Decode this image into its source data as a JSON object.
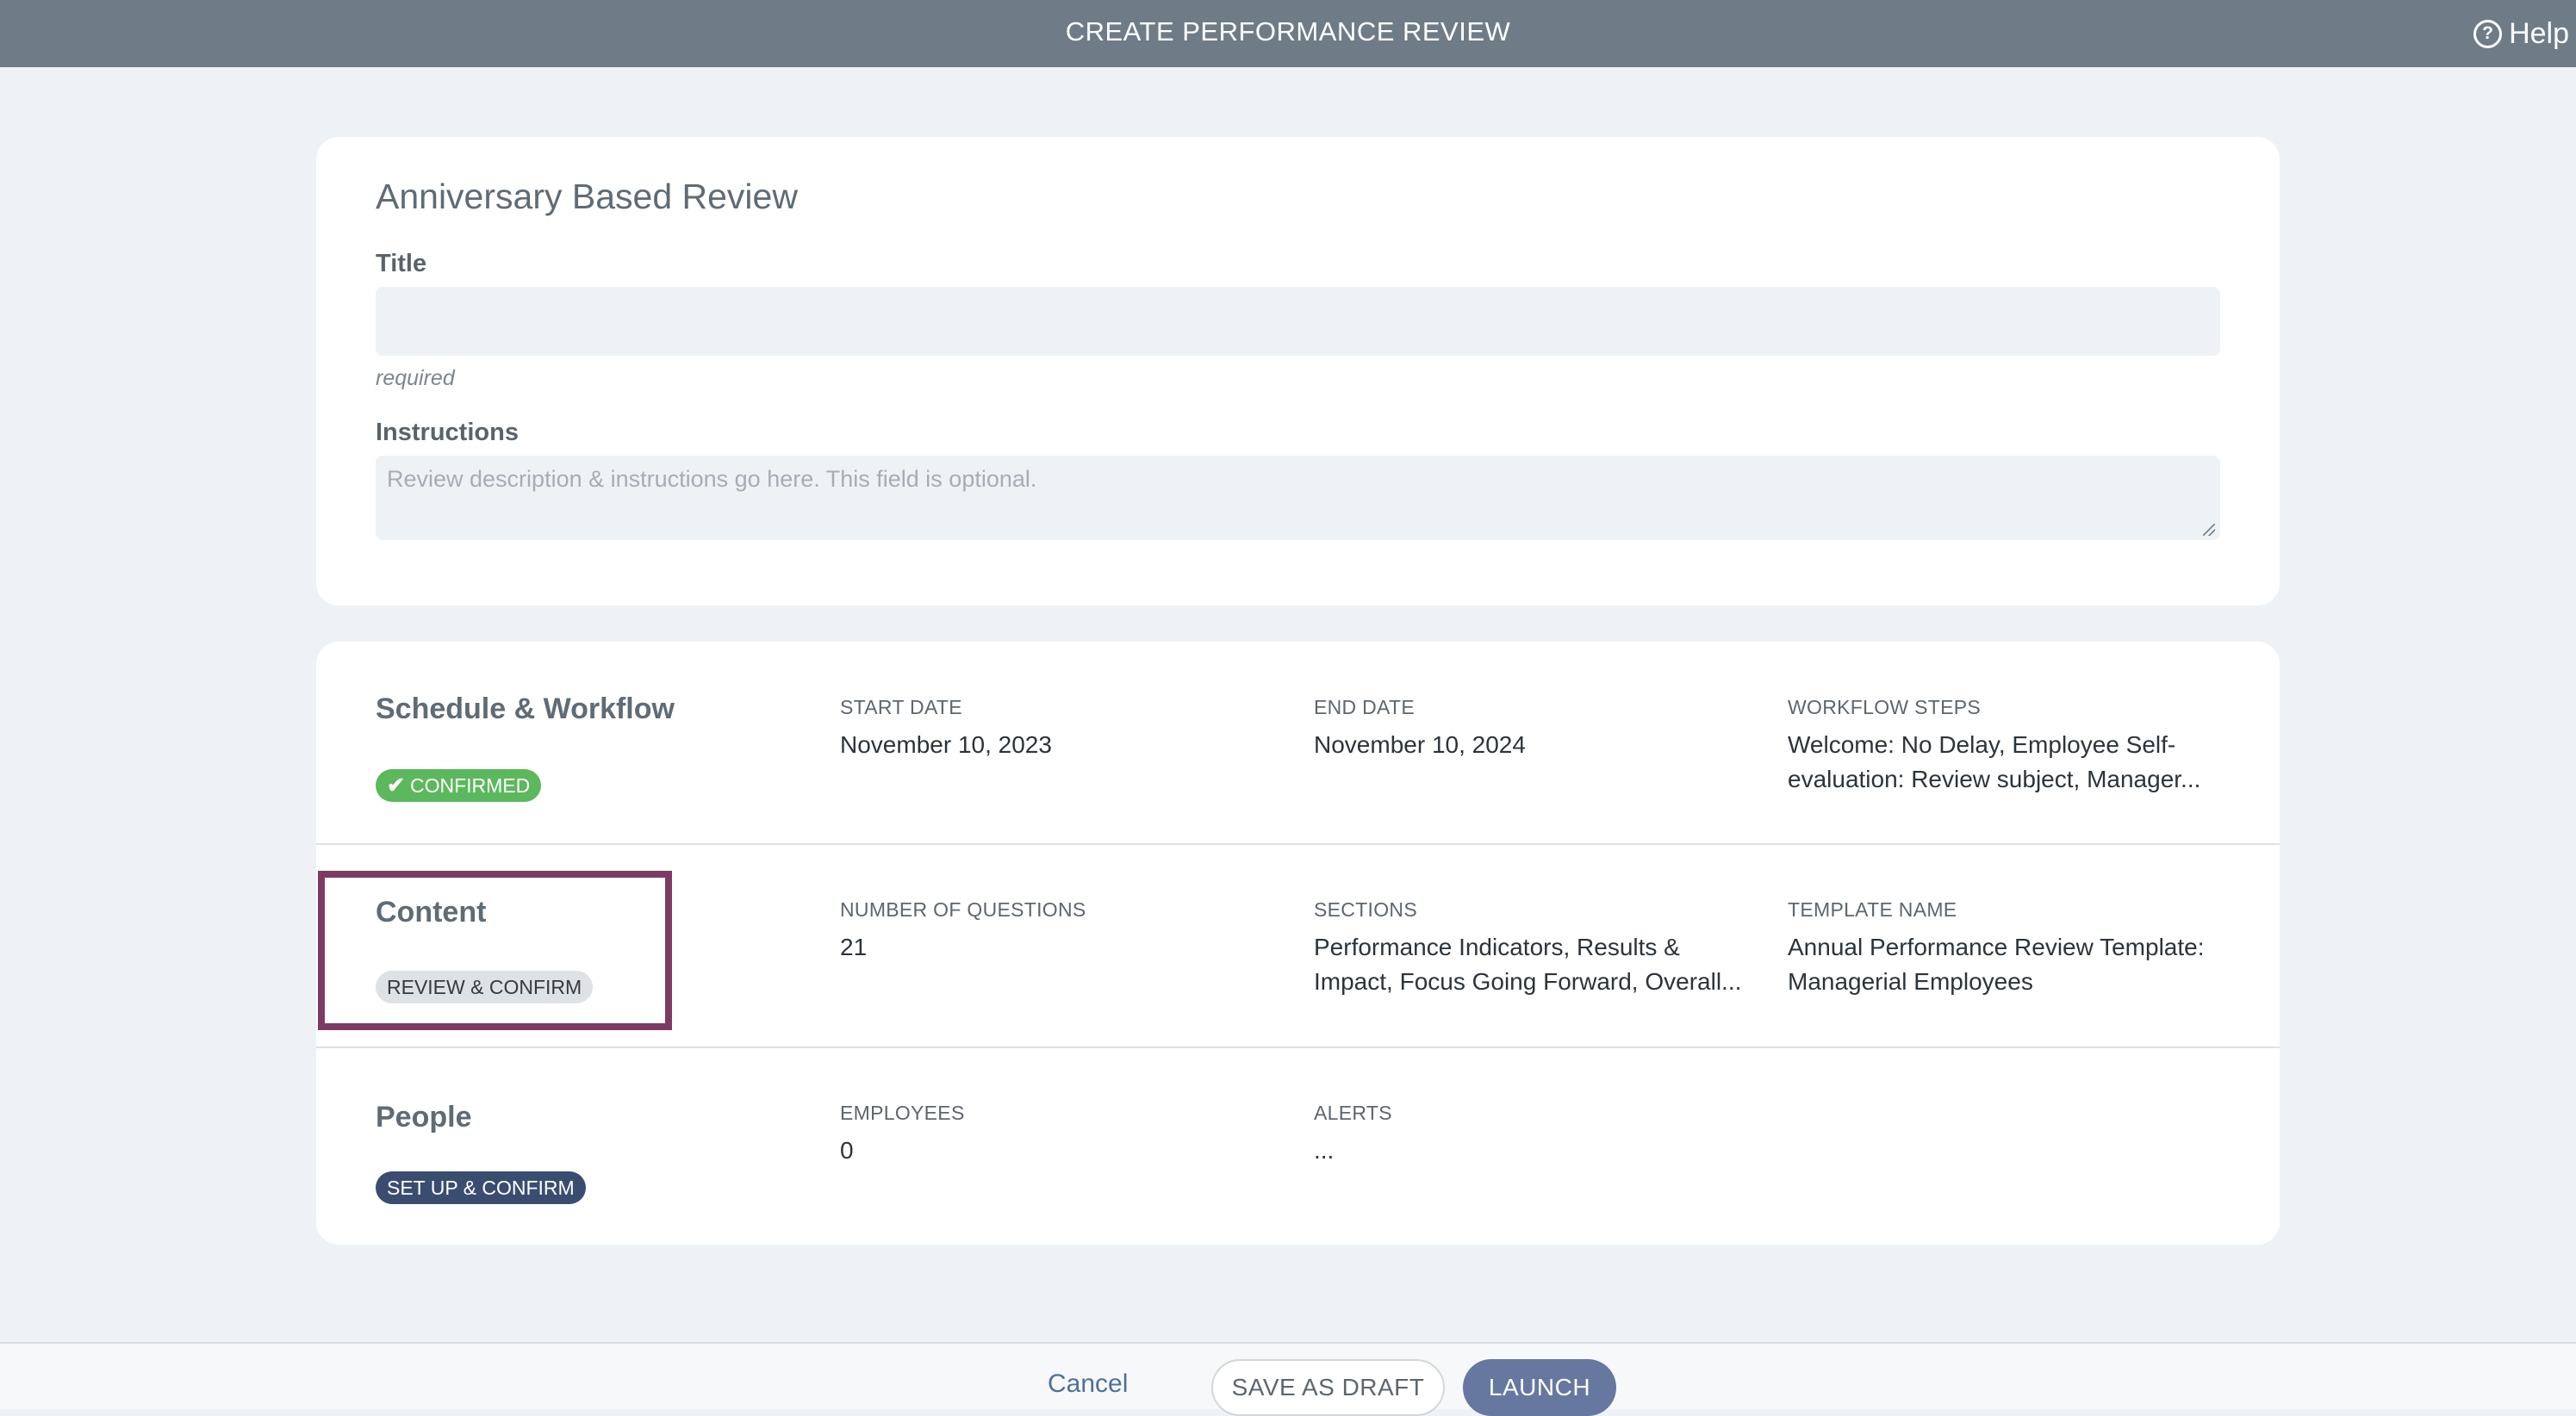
{
  "header": {
    "title": "CREATE PERFORMANCE REVIEW",
    "help_label": "Help"
  },
  "form": {
    "review_type": "Anniversary Based Review",
    "title_label": "Title",
    "title_value": "",
    "title_hint": "required",
    "instructions_label": "Instructions",
    "instructions_placeholder": "Review description & instructions go here.  This field is optional."
  },
  "sections": {
    "schedule": {
      "title": "Schedule & Workflow",
      "badge": "CONFIRMED",
      "start_label": "START DATE",
      "start_value": "November 10, 2023",
      "end_label": "END DATE",
      "end_value": "November 10, 2024",
      "workflow_label": "WORKFLOW STEPS",
      "workflow_line1": "Welcome: No Delay, Employee Self-",
      "workflow_line2": "evaluation: Review subject, Manager..."
    },
    "content": {
      "title": "Content",
      "badge": "REVIEW & CONFIRM",
      "questions_label": "NUMBER OF QUESTIONS",
      "questions_value": "21",
      "sections_label": "SECTIONS",
      "sections_line1": "Performance Indicators, Results &",
      "sections_line2": "Impact, Focus Going Forward, Overall...",
      "template_label": "TEMPLATE NAME",
      "template_line1": "Annual Performance Review Template:",
      "template_line2": "Managerial Employees"
    },
    "people": {
      "title": "People",
      "badge": "SET UP & CONFIRM",
      "employees_label": "EMPLOYEES",
      "employees_value": "0",
      "alerts_label": "ALERTS",
      "alerts_value": "..."
    }
  },
  "footer": {
    "cancel_label": "Cancel",
    "draft_label": "SAVE AS DRAFT",
    "launch_label": "LAUNCH"
  },
  "colors": {
    "topbar": "#6f7c87",
    "confirmed_badge": "#5cb85c",
    "setup_badge": "#3a4d70",
    "highlight": "#7d3b64",
    "launch_button": "#6678a0"
  }
}
